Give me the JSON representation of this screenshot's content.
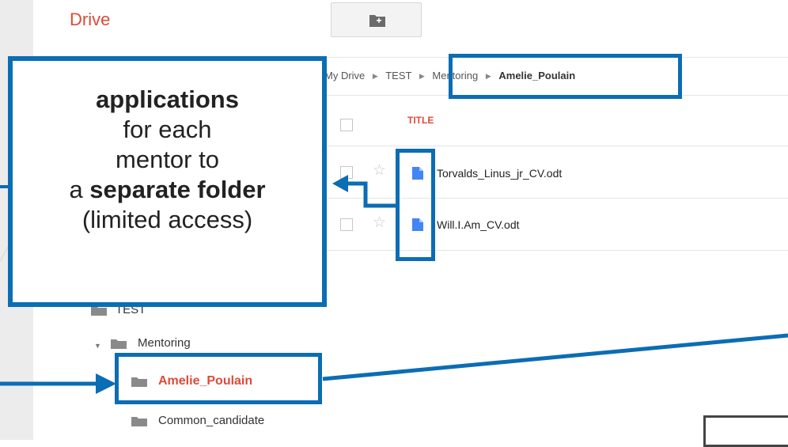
{
  "app": {
    "logo_text": "Drive"
  },
  "breadcrumb": {
    "items": [
      "My Drive",
      "TEST",
      "Mentoring"
    ],
    "current": "Amelie_Poulain",
    "separator": "▶"
  },
  "file_list": {
    "column_title": "TITLE",
    "files": [
      {
        "name": "Torvalds_Linus_jr_CV.odt",
        "icon": "document-icon"
      },
      {
        "name": "Will.I.Am_CV.odt",
        "icon": "document-icon"
      }
    ]
  },
  "folder_tree": {
    "items": [
      {
        "label": "TEST"
      },
      {
        "label": "Mentoring"
      },
      {
        "label": "Amelie_Poulain",
        "selected": true
      },
      {
        "label": "Common_candidate"
      }
    ]
  },
  "callout": {
    "line1_bold": "applications",
    "line2": "for each",
    "line3": "mentor to",
    "line4_prefix": "a ",
    "line4_bold": "separate folder",
    "line5": "(limited access)"
  },
  "colors": {
    "annotation_blue": "#0b6db4",
    "drive_red": "#dd4b39",
    "doc_blue": "#4285f4",
    "folder_gray": "#8a8a8a"
  }
}
